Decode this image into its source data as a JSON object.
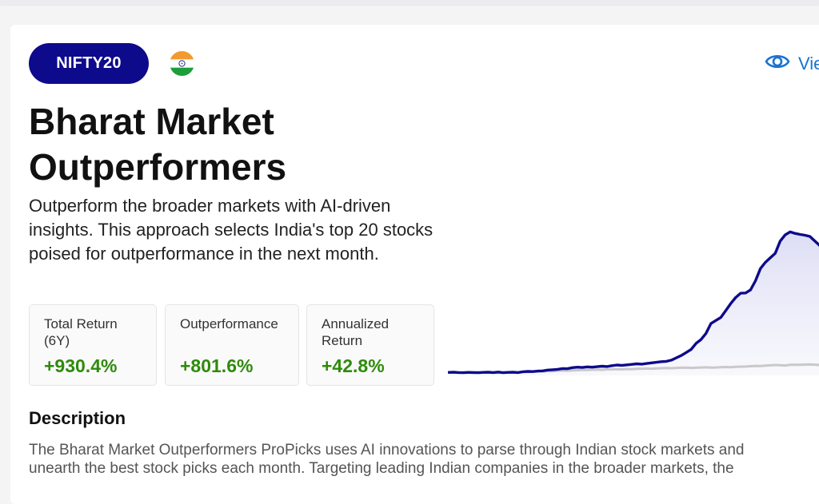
{
  "header": {
    "badge": "NIFTY20",
    "flag_icon": "india-flag-icon",
    "view_link": "Vie"
  },
  "strategy": {
    "title": "Bharat Market Outperformers",
    "description": "Outperform the broader markets with AI-driven insights. This approach selects India's top 20 stocks poised for outperformance in the next month."
  },
  "stats": [
    {
      "label": "Total Return (6Y)",
      "value": "+930.4%"
    },
    {
      "label": "Outperformance",
      "value": "+801.6%"
    },
    {
      "label": "Annualized Return",
      "value": "+42.8%"
    }
  ],
  "description_section": {
    "heading": "Description",
    "lines": [
      "The Bharat Market Outperformers ProPicks uses AI innovations to parse through Indian stock markets and",
      "unearth the best stock picks each month. Targeting leading Indian companies in the broader markets, the"
    ]
  },
  "colors": {
    "brand_navy": "#0d0a8c",
    "positive_green": "#2e8b0b",
    "link_blue": "#1a73d1",
    "benchmark_gray": "#c9c9c9"
  },
  "chart_data": {
    "type": "line",
    "title": "",
    "xlabel": "",
    "ylabel": "",
    "grid": false,
    "legend": "none",
    "x": [
      0,
      1,
      2,
      3,
      4,
      5,
      6,
      7,
      8,
      9,
      10,
      11,
      12,
      13,
      14,
      15,
      16,
      17,
      18,
      19,
      20,
      21,
      22,
      23,
      24,
      25,
      26,
      27,
      28,
      29,
      30,
      31,
      32,
      33,
      34,
      35,
      36,
      37,
      38,
      39,
      40,
      41,
      42,
      43,
      44,
      45,
      46,
      47,
      48,
      49,
      50,
      51,
      52,
      53,
      54,
      55,
      56,
      57,
      58,
      59,
      60,
      61,
      62,
      63,
      64,
      65,
      66,
      67,
      68,
      69,
      70,
      71,
      72,
      73,
      74,
      75
    ],
    "series": [
      {
        "name": "",
        "color": "#0d0a8c",
        "values": [
          100,
          101,
          99,
          98,
          100,
          99,
          98,
          100,
          101,
          99,
          102,
          98,
          100,
          101,
          99,
          104,
          106,
          105,
          108,
          110,
          115,
          117,
          120,
          125,
          124,
          131,
          134,
          132,
          136,
          134,
          137,
          140,
          138,
          144,
          148,
          146,
          149,
          152,
          156,
          154,
          158,
          162,
          166,
          170,
          172,
          180,
          195,
          210,
          230,
          250,
          290,
          315,
          355,
          420,
          440,
          460,
          505,
          550,
          590,
          618,
          620,
          640,
          700,
          780,
          820,
          850,
          880,
          960,
          1000,
          1020,
          1010,
          1003,
          998,
          990,
          960,
          930
        ],
        "fill": true
      },
      {
        "name": "",
        "color": "#c9c9c9",
        "values": [
          100,
          101,
          100,
          99,
          100,
          101,
          100,
          99,
          100,
          98,
          97,
          99,
          100,
          101,
          100,
          103,
          102,
          104,
          106,
          105,
          108,
          107,
          110,
          112,
          111,
          113,
          114,
          116,
          115,
          117,
          118,
          116,
          119,
          120,
          121,
          120,
          122,
          121,
          123,
          124,
          125,
          124,
          126,
          127,
          128,
          127,
          129,
          130,
          131,
          129,
          130,
          132,
          133,
          131,
          132,
          134,
          135,
          134,
          136,
          137,
          138,
          140,
          142,
          141,
          144,
          146,
          148,
          147,
          145,
          149,
          150,
          149,
          151,
          152,
          150,
          148
        ]
      }
    ],
    "ylim": [
      80,
      1100
    ]
  }
}
